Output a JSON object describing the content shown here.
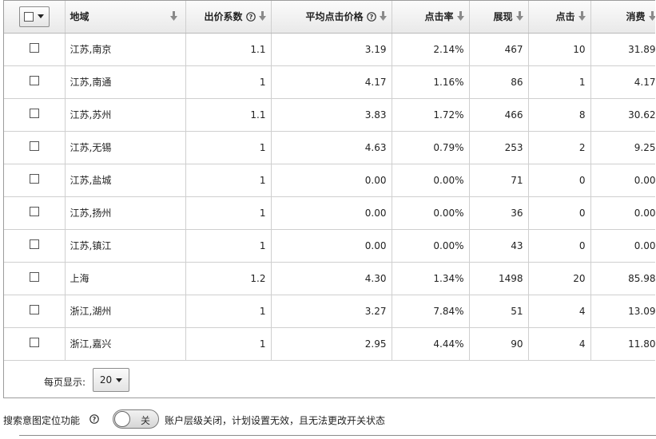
{
  "table": {
    "columns": [
      {
        "key": "select",
        "label": "",
        "sortable": false
      },
      {
        "key": "region",
        "label": "地域",
        "sortable": true,
        "help": false,
        "align": "l"
      },
      {
        "key": "bid",
        "label": "出价系数",
        "sortable": true,
        "help": true,
        "align": "r"
      },
      {
        "key": "avg_cpc",
        "label": "平均点击价格",
        "sortable": true,
        "help": true,
        "align": "r"
      },
      {
        "key": "ctr",
        "label": "点击率",
        "sortable": true,
        "help": false,
        "align": "r"
      },
      {
        "key": "impressions",
        "label": "展现",
        "sortable": true,
        "help": false,
        "align": "r"
      },
      {
        "key": "clicks",
        "label": "点击",
        "sortable": true,
        "help": false,
        "align": "r"
      },
      {
        "key": "cost",
        "label": "消费",
        "sortable": true,
        "help": false,
        "align": "r"
      }
    ],
    "rows": [
      {
        "region": "江苏,南京",
        "bid": "1.1",
        "avg_cpc": "3.19",
        "ctr": "2.14%",
        "impressions": "467",
        "clicks": "10",
        "cost": "31.89",
        "checked": false
      },
      {
        "region": "江苏,南通",
        "bid": "1",
        "avg_cpc": "4.17",
        "ctr": "1.16%",
        "impressions": "86",
        "clicks": "1",
        "cost": "4.17",
        "checked": false
      },
      {
        "region": "江苏,苏州",
        "bid": "1.1",
        "avg_cpc": "3.83",
        "ctr": "1.72%",
        "impressions": "466",
        "clicks": "8",
        "cost": "30.62",
        "checked": false
      },
      {
        "region": "江苏,无锡",
        "bid": "1",
        "avg_cpc": "4.63",
        "ctr": "0.79%",
        "impressions": "253",
        "clicks": "2",
        "cost": "9.25",
        "checked": false
      },
      {
        "region": "江苏,盐城",
        "bid": "1",
        "avg_cpc": "0.00",
        "ctr": "0.00%",
        "impressions": "71",
        "clicks": "0",
        "cost": "0.00",
        "checked": false
      },
      {
        "region": "江苏,扬州",
        "bid": "1",
        "avg_cpc": "0.00",
        "ctr": "0.00%",
        "impressions": "36",
        "clicks": "0",
        "cost": "0.00",
        "checked": false
      },
      {
        "region": "江苏,镇江",
        "bid": "1",
        "avg_cpc": "0.00",
        "ctr": "0.00%",
        "impressions": "43",
        "clicks": "0",
        "cost": "0.00",
        "checked": false
      },
      {
        "region": "上海",
        "bid": "1.2",
        "avg_cpc": "4.30",
        "ctr": "1.34%",
        "impressions": "1498",
        "clicks": "20",
        "cost": "85.98",
        "checked": false
      },
      {
        "region": "浙江,湖州",
        "bid": "1",
        "avg_cpc": "3.27",
        "ctr": "7.84%",
        "impressions": "51",
        "clicks": "4",
        "cost": "13.09",
        "checked": false
      },
      {
        "region": "浙江,嘉兴",
        "bid": "1",
        "avg_cpc": "2.95",
        "ctr": "4.44%",
        "impressions": "90",
        "clicks": "4",
        "cost": "11.80",
        "checked": false
      }
    ]
  },
  "pager": {
    "label": "每页显示:",
    "page_size": "20"
  },
  "feature": {
    "label": "搜索意图定位功能",
    "toggle_text": "关",
    "toggle_on": false,
    "note": "账户层级关闭，计划设置无效，且无法更改开关状态"
  },
  "icons": {
    "sort": "sort-down-arrow-icon",
    "help": "question-circle-icon",
    "dropdown": "caret-down-icon"
  },
  "colors": {
    "border": "#cfcfcf",
    "header_bg": "#ececec",
    "frame": "#9c9c9c"
  }
}
